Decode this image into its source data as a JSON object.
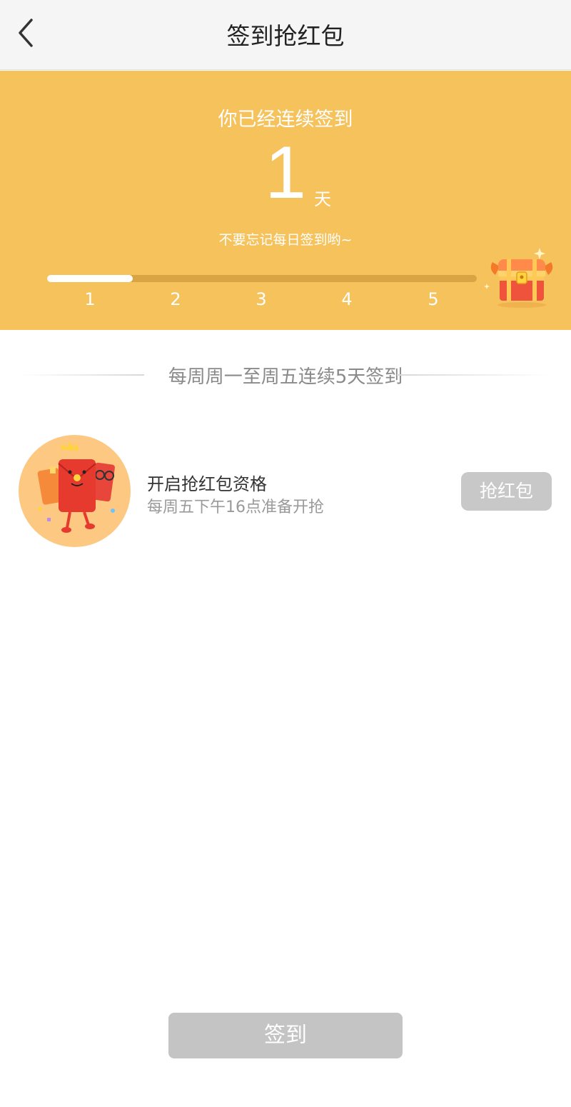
{
  "header": {
    "title": "签到抢红包",
    "back_icon": "chevron-left-icon"
  },
  "banner": {
    "background_color": "#f6c25c",
    "streak_label": "你已经连续签到",
    "streak_count": "1",
    "streak_unit": "天",
    "reminder": "不要忘记每日签到哟~",
    "progress": {
      "current_day": 1,
      "total_days": 5,
      "fill_fraction": 0.2,
      "days": [
        "1",
        "2",
        "3",
        "4",
        "5"
      ]
    },
    "chest_icon": "treasure-chest-icon"
  },
  "section": {
    "title": "每周周一至周五连续5天签到"
  },
  "reward_item": {
    "avatar_icon": "red-envelope-mascot-icon",
    "title": "开启抢红包资格",
    "subtitle": "每周五下午16点准备开抢",
    "button_label": "抢红包"
  },
  "signin_button": {
    "label": "签到"
  }
}
